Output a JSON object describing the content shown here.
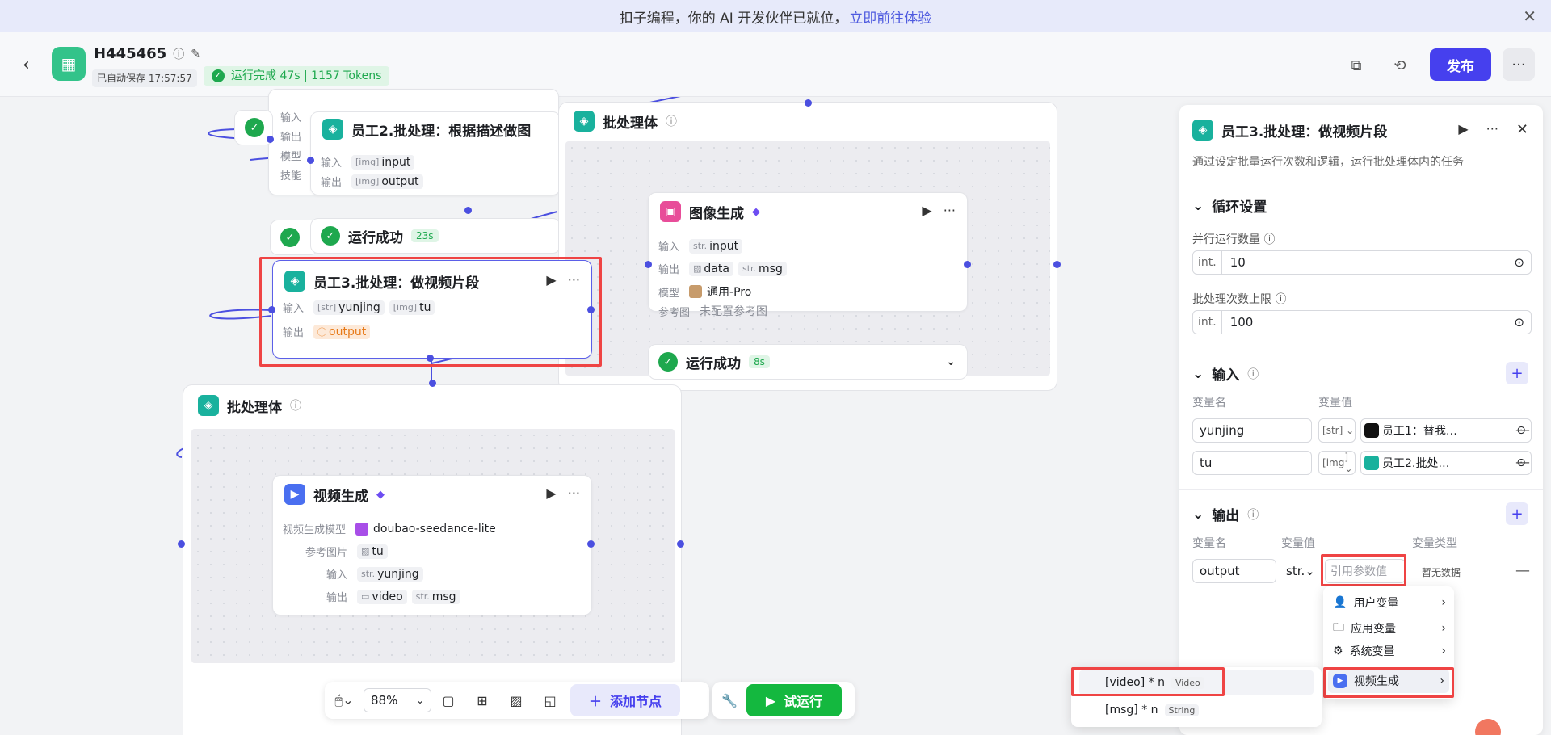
{
  "banner": {
    "text": "扣子编程，你的 AI 开发伙伴已就位，",
    "link": "立即前往体验"
  },
  "header": {
    "title": "H445465",
    "autosave": "已自动保存 17:57:57",
    "run_status": "运行完成 47s | 1157 Tokens",
    "publish_label": "发布"
  },
  "nodes": {
    "top_partial": {
      "in_label": "输入",
      "out_label": "输出",
      "model_label": "模型",
      "skill_label": "技能"
    },
    "emp2": {
      "title": "员工2.批处理：根据描述做图",
      "in_label": "输入",
      "in_value": "input",
      "out_label": "输出",
      "out_value": "output",
      "status": "运行成功",
      "duration": "23s"
    },
    "emp3": {
      "title": "员工3.批处理：做视频片段",
      "in_label": "输入",
      "in_v1": "yunjing",
      "in_v2": "tu",
      "out_label": "输出",
      "out_value": "output"
    },
    "batch1": {
      "title": "批处理体"
    },
    "img_gen": {
      "title": "图像生成",
      "in_label": "输入",
      "in_type": "str.",
      "in_value": "input",
      "out_label": "输出",
      "out_v1": "data",
      "out_type2": "str.",
      "out_v2": "msg",
      "model_label": "模型",
      "model_value": "通用-Pro",
      "ref_label": "参考图",
      "ref_value": "未配置参考图",
      "status": "运行成功",
      "duration": "8s"
    },
    "batch2": {
      "title": "批处理体"
    },
    "video_gen": {
      "title": "视频生成",
      "model_label": "视频生成模型",
      "model_value": "doubao-seedance-lite",
      "ref_label": "参考图片",
      "ref_value": "tu",
      "in_label": "输入",
      "in_type": "str.",
      "in_value": "yunjing",
      "out_label": "输出",
      "out_v1": "video",
      "out_type2": "str.",
      "out_v2": "msg"
    }
  },
  "toolbar": {
    "zoom": "88%",
    "add_node": "添加节点",
    "test_run": "试运行"
  },
  "panel": {
    "title": "员工3.批处理：做视频片段",
    "desc": "通过设定批量运行次数和逻辑，运行批处理体内的任务",
    "loop_section": "循环设置",
    "parallel_label": "并行运行数量",
    "parallel_type": "int.",
    "parallel_value": "10",
    "max_label": "批处理次数上限",
    "max_type": "int.",
    "max_value": "100",
    "input_section": "输入",
    "var_name_header": "变量名",
    "var_value_header": "变量值",
    "inputs": [
      {
        "name": "yunjing",
        "type": "str",
        "ref": "员工1：替我…"
      },
      {
        "name": "tu",
        "type": "img",
        "ref": "员工2.批处…"
      }
    ],
    "output_section": "输出",
    "out_name_header": "变量名",
    "out_value_header": "变量值",
    "out_type_header": "变量类型",
    "output": {
      "name": "output",
      "type": "str.",
      "placeholder": "引用参数值",
      "vtype": "暂无数据"
    }
  },
  "dropdown": {
    "items": [
      "用户变量",
      "应用变量",
      "系统变量",
      "视频生成"
    ],
    "sub_items": [
      {
        "label": "[video] * n",
        "type": "Video"
      },
      {
        "label": "[msg] * n",
        "type": "String"
      }
    ]
  },
  "colors": {
    "accent": "#4640ee",
    "success": "#1ea84e",
    "highlight": "#ef4444",
    "teal": "#19b19d"
  }
}
